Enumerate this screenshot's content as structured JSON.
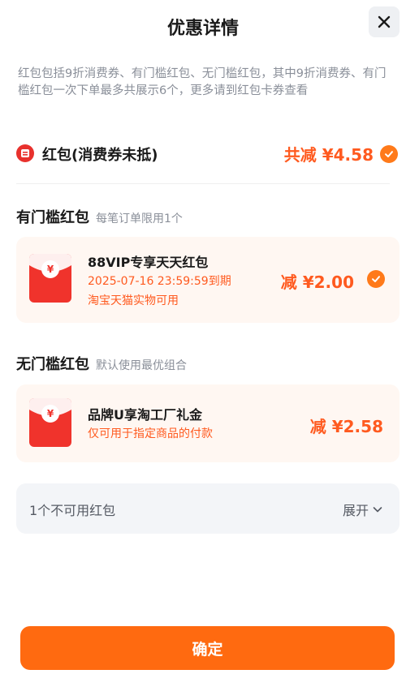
{
  "header": {
    "title": "优惠详情",
    "close_icon": "close-icon"
  },
  "description": "红包包括9折消费券、有门槛红包、无门槛红包，其中9折消费券、有门槛红包一次下单最多共展示6个，更多请到红包卡券查看",
  "summary": {
    "label": "红包(消费券未抵)",
    "total": "共减 ¥4.58",
    "checked": true
  },
  "threshold_section": {
    "title": "有门槛红包",
    "subtitle": "每笔订单限用1个",
    "card": {
      "name": "88VIP专享天天红包",
      "expiry": "2025-07-16 23:59:59到期",
      "scope": "淘宝天猫实物可用",
      "amount": "减 ¥2.00",
      "checked": true
    }
  },
  "no_threshold_section": {
    "title": "无门槛红包",
    "subtitle": "默认使用最优组合",
    "card": {
      "name": "品牌U享淘工厂礼金",
      "note": "仅可用于指定商品的付款",
      "amount": "减 ¥2.58"
    }
  },
  "unavailable": {
    "label": "1个不可用红包",
    "expand": "展开"
  },
  "confirm_button": "确定",
  "colors": {
    "accent": "#ff6a10",
    "price": "#ff5a1f",
    "envelope": "#f0332c",
    "card_bg": "#fff7f2"
  }
}
